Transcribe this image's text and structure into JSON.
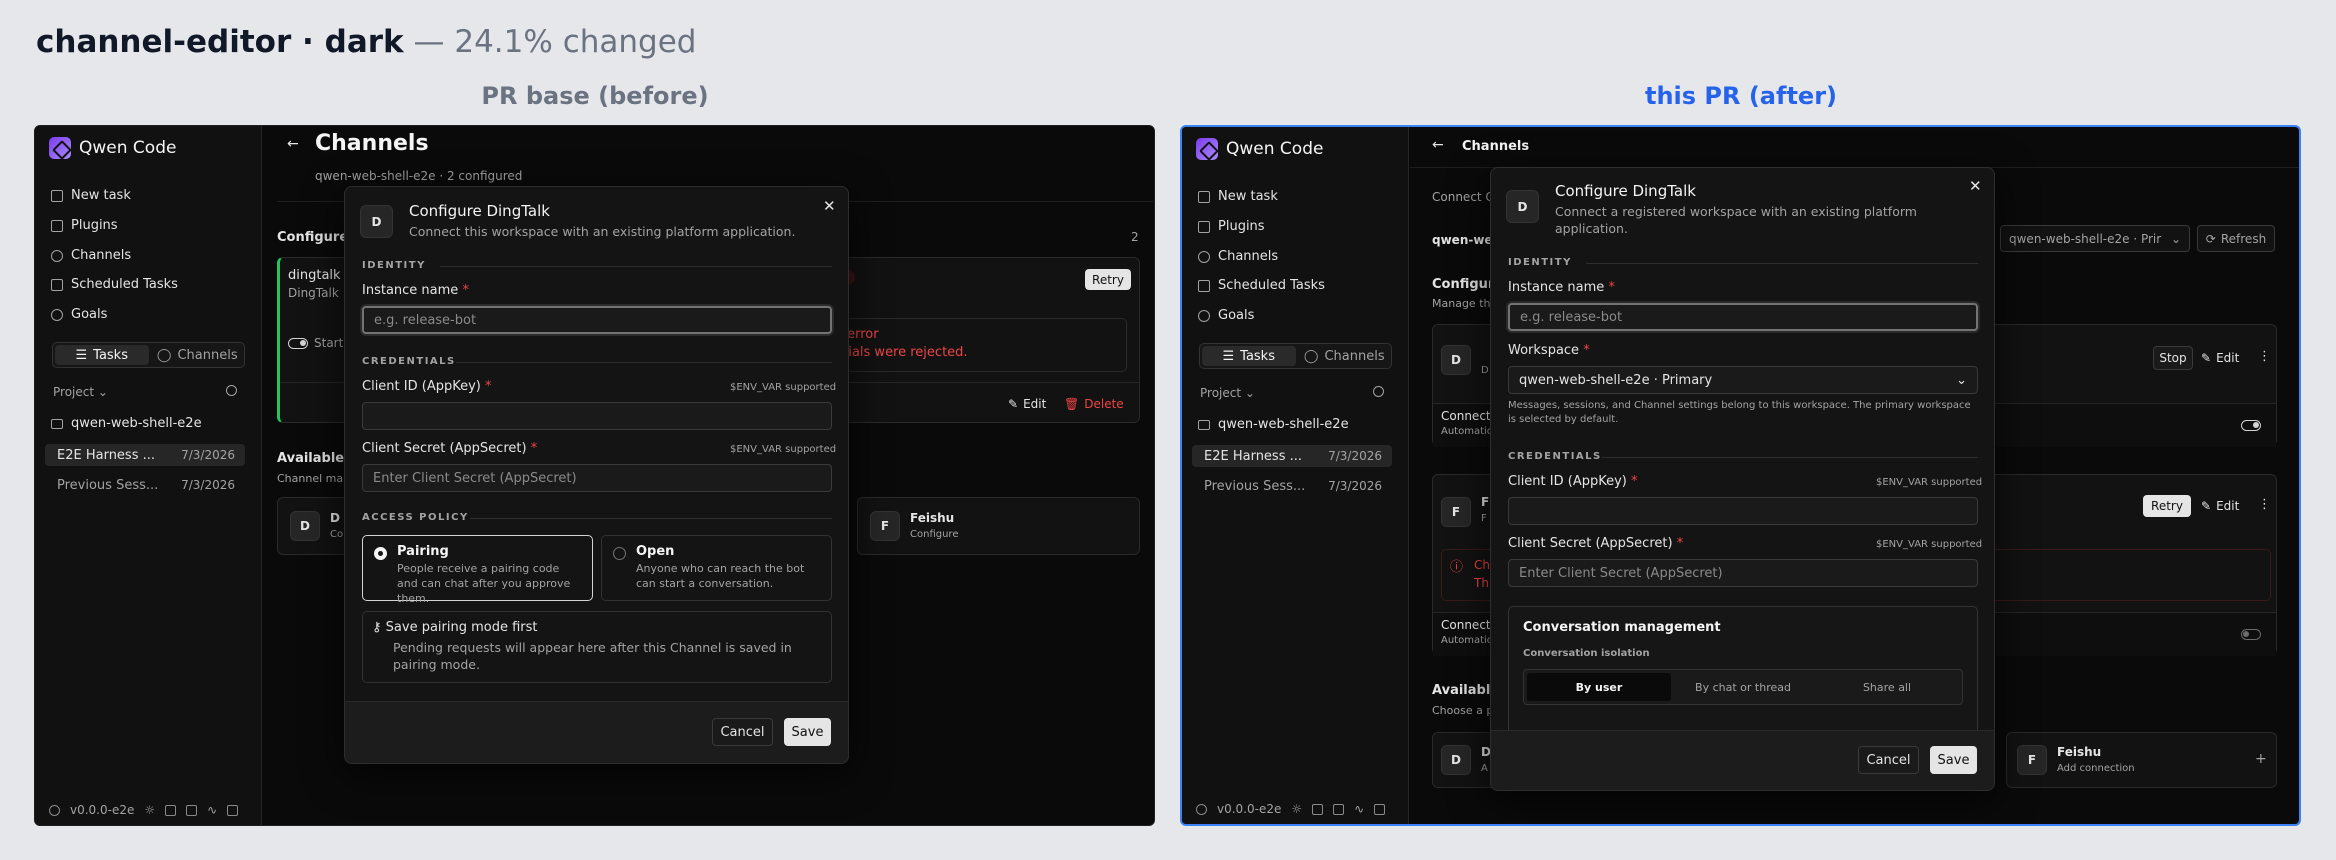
{
  "header": {
    "title": "channel-editor · dark",
    "subtitle": "— 24.1% changed"
  },
  "captions": {
    "before": "PR base (before)",
    "after": "this PR (after)"
  },
  "colors": {
    "before_caption": "#6b7280",
    "after_caption": "#2563eb",
    "accent_border": "#3b82f6",
    "required": "#ef4444"
  },
  "sidebar": {
    "app_name": "Qwen Code",
    "nav": [
      {
        "label": "New task",
        "icon": "edit-icon"
      },
      {
        "label": "Plugins",
        "icon": "puzzle-icon"
      },
      {
        "label": "Channels",
        "icon": "chat-icon"
      },
      {
        "label": "Scheduled Tasks",
        "icon": "calendar-icon"
      },
      {
        "label": "Goals",
        "icon": "target-icon"
      }
    ],
    "tabs": {
      "tasks": "Tasks",
      "channels": "Channels"
    },
    "project_label": "Project",
    "workspace": "qwen-web-shell-e2e",
    "tasks": [
      {
        "title": "E2E Harness ...",
        "date": "7/3/2026"
      },
      {
        "title": "Previous Sess...",
        "date": "7/3/2026"
      }
    ],
    "version": "v0.0.0-e2e"
  },
  "before": {
    "page_title": "Channels",
    "page_sub": "qwen-web-shell-e2e · 2 configured",
    "configured_heading": "Configure",
    "count": "2",
    "channel_name": "dingtalk",
    "channel_type": "DingTalk",
    "error_badge": "or",
    "retry": "Retry",
    "error_line1": "e error",
    "error_line2": "ntials were rejected.",
    "start_label": "Start",
    "edit": "Edit",
    "delete": "Delete",
    "available_heading": "Available",
    "available_sub": "Channel ma",
    "avail_d": "D",
    "avail_d_sub": "Co",
    "feishu": "Feishu",
    "feishu_sub": "Configure",
    "modal": {
      "avatar": "D",
      "title": "Configure DingTalk",
      "desc": "Connect this workspace with an existing platform application.",
      "identity": "IDENTITY",
      "instance_label": "Instance name",
      "instance_placeholder": "e.g. release-bot",
      "credentials": "CREDENTIALS",
      "client_id_label": "Client ID (AppKey)",
      "env_note": "$ENV_VAR supported",
      "client_secret_label": "Client Secret (AppSecret)",
      "client_secret_placeholder": "Enter Client Secret (AppSecret)",
      "access_policy": "ACCESS POLICY",
      "pairing_title": "Pairing",
      "pairing_desc": "People receive a pairing code and can chat after you approve them.",
      "open_title": "Open",
      "open_desc": "Anyone who can reach the bot can start a conversation.",
      "note_title": "Save pairing mode first",
      "note_desc": "Pending requests will appear here after this Channel is saved in pairing mode.",
      "cancel": "Cancel",
      "save": "Save"
    }
  },
  "after": {
    "page_title": "Channels",
    "connect_hint": "Connect Q",
    "ws_label": "qwen-we",
    "ws_select": "qwen-web-shell-e2e · Prir",
    "refresh": "Refresh",
    "configured_heading": "Configur",
    "manage_hint": "Manage the",
    "card1_avatar": "D",
    "card1_sub": "D",
    "stop": "Stop",
    "edit": "Edit",
    "connect_label": "Connect",
    "automation": "Automatio",
    "card2_avatar": "F",
    "card2_name": "F",
    "card2_sub": "F",
    "retry": "Retry",
    "err1": "Ch",
    "err2": "Th",
    "available_heading": "Availabl",
    "choose_hint": "Choose a p",
    "avail_d": "D",
    "avail_d_name": "D",
    "avail_d_sub": "A",
    "feishu": "Feishu",
    "feishu_sub": "Add connection",
    "modal": {
      "avatar": "D",
      "title": "Configure DingTalk",
      "desc": "Connect a registered workspace with an existing platform application.",
      "identity": "IDENTITY",
      "instance_label": "Instance name",
      "instance_placeholder": "e.g. release-bot",
      "workspace_label": "Workspace",
      "workspace_value": "qwen-web-shell-e2e · Primary",
      "workspace_help": "Messages, sessions, and Channel settings belong to this workspace. The primary workspace is selected by default.",
      "credentials": "CREDENTIALS",
      "client_id_label": "Client ID (AppKey)",
      "env_note": "$ENV_VAR supported",
      "client_secret_label": "Client Secret (AppSecret)",
      "client_secret_placeholder": "Enter Client Secret (AppSecret)",
      "conv_title": "Conversation management",
      "conv_isolation": "Conversation isolation",
      "iso_options": [
        "By user",
        "By chat or thread",
        "Share all"
      ],
      "cancel": "Cancel",
      "save": "Save"
    }
  }
}
